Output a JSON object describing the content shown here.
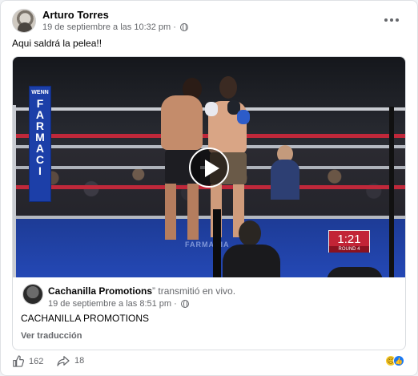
{
  "post": {
    "author": "Arturo Torres",
    "timestamp": "19 de septiembre a las 10:32 pm",
    "audience_icon": "globe-icon",
    "text": "Aqui saldrá la pelea!!",
    "more_icon": "more-horizontal-icon"
  },
  "shared_video": {
    "banner_top": "WENN",
    "banner_main": "FARMACIA",
    "canvas_text": "FARMACIA",
    "clock": {
      "time": "1:21",
      "round": "ROUND 4"
    },
    "play_icon": "play-icon"
  },
  "source_page": {
    "name": "Cachanilla Promotions",
    "action": "” transmitió en vivo.",
    "timestamp": "19 de septiembre a las 8:51 pm",
    "text": "CACHANILLA PROMOTIONS",
    "translate_label": "Ver traducción"
  },
  "footer": {
    "like_count": "162",
    "share_count": "18",
    "reactions": [
      "sad-emoji-icon",
      "like-icon"
    ]
  },
  "colors": {
    "text_primary": "#050505",
    "text_secondary": "#65676b",
    "facebook_blue": "#1877f2",
    "clock_red": "#c22436"
  }
}
